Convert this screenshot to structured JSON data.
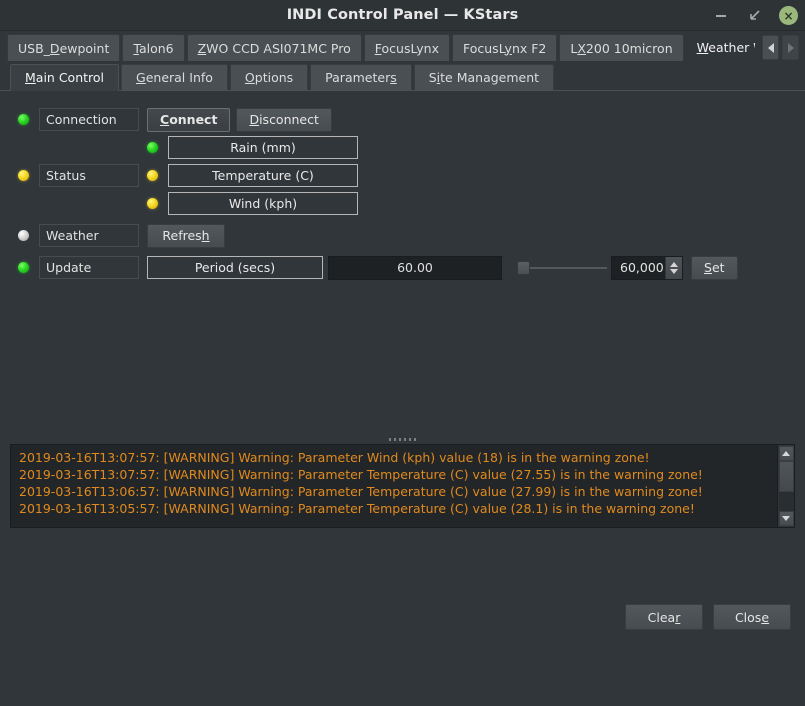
{
  "window": {
    "title": "INDI Control Panel — KStars",
    "controls": {
      "minimize": "minimize-icon",
      "maximize": "restore-icon",
      "close": "×"
    }
  },
  "device_tabs": {
    "items": [
      {
        "label": "USB_Dewpoint",
        "active": false
      },
      {
        "label": "Talon6",
        "active": false
      },
      {
        "label": "ZWO CCD ASI071MC Pro",
        "active": false
      },
      {
        "label": "FocusLynx",
        "active": false
      },
      {
        "label": "FocusLynx F2",
        "active": false
      },
      {
        "label": "LX200 10micron",
        "active": false
      },
      {
        "label": "Weather Watcher",
        "active": true
      }
    ],
    "scroll_left": "chevron-left-icon",
    "scroll_right": "chevron-right-icon"
  },
  "sub_tabs": {
    "items": [
      {
        "label": "Main Control",
        "active": true
      },
      {
        "label": "General Info",
        "active": false
      },
      {
        "label": "Options",
        "active": false
      },
      {
        "label": "Parameters",
        "active": false
      },
      {
        "label": "Site Management",
        "active": false
      }
    ]
  },
  "main": {
    "connection": {
      "led": "green",
      "name": "Connection",
      "connect_label": "Connect",
      "disconnect_label": "Disconnect"
    },
    "status": {
      "led": "yellow",
      "name": "Status",
      "params": [
        {
          "led": "green",
          "label": "Rain (mm)"
        },
        {
          "led": "yellow",
          "label": "Temperature (C)"
        },
        {
          "led": "yellow",
          "label": "Wind (kph)"
        }
      ]
    },
    "weather": {
      "led": "grey",
      "name": "Weather",
      "refresh_label": "Refresh"
    },
    "update": {
      "led": "green",
      "name": "Update",
      "period_label": "Period (secs)",
      "period_value": "60.00",
      "slider_value": 0,
      "spin_value": "60,000",
      "set_label": "Set"
    }
  },
  "log": {
    "lines": [
      "2019-03-16T13:07:57: [WARNING] Warning: Parameter Wind (kph) value (18) is in the warning zone!",
      "2019-03-16T13:07:57: [WARNING] Warning: Parameter Temperature (C) value (27.55) is in the warning zone!",
      "2019-03-16T13:06:57: [WARNING] Warning: Parameter Temperature (C) value (27.99) is in the warning zone!",
      "2019-03-16T13:05:57: [WARNING] Warning: Parameter Temperature (C) value (28.1) is in the warning zone!"
    ],
    "color": "#e08a1e"
  },
  "footer": {
    "clear_label": "Clear",
    "close_label": "Close"
  }
}
